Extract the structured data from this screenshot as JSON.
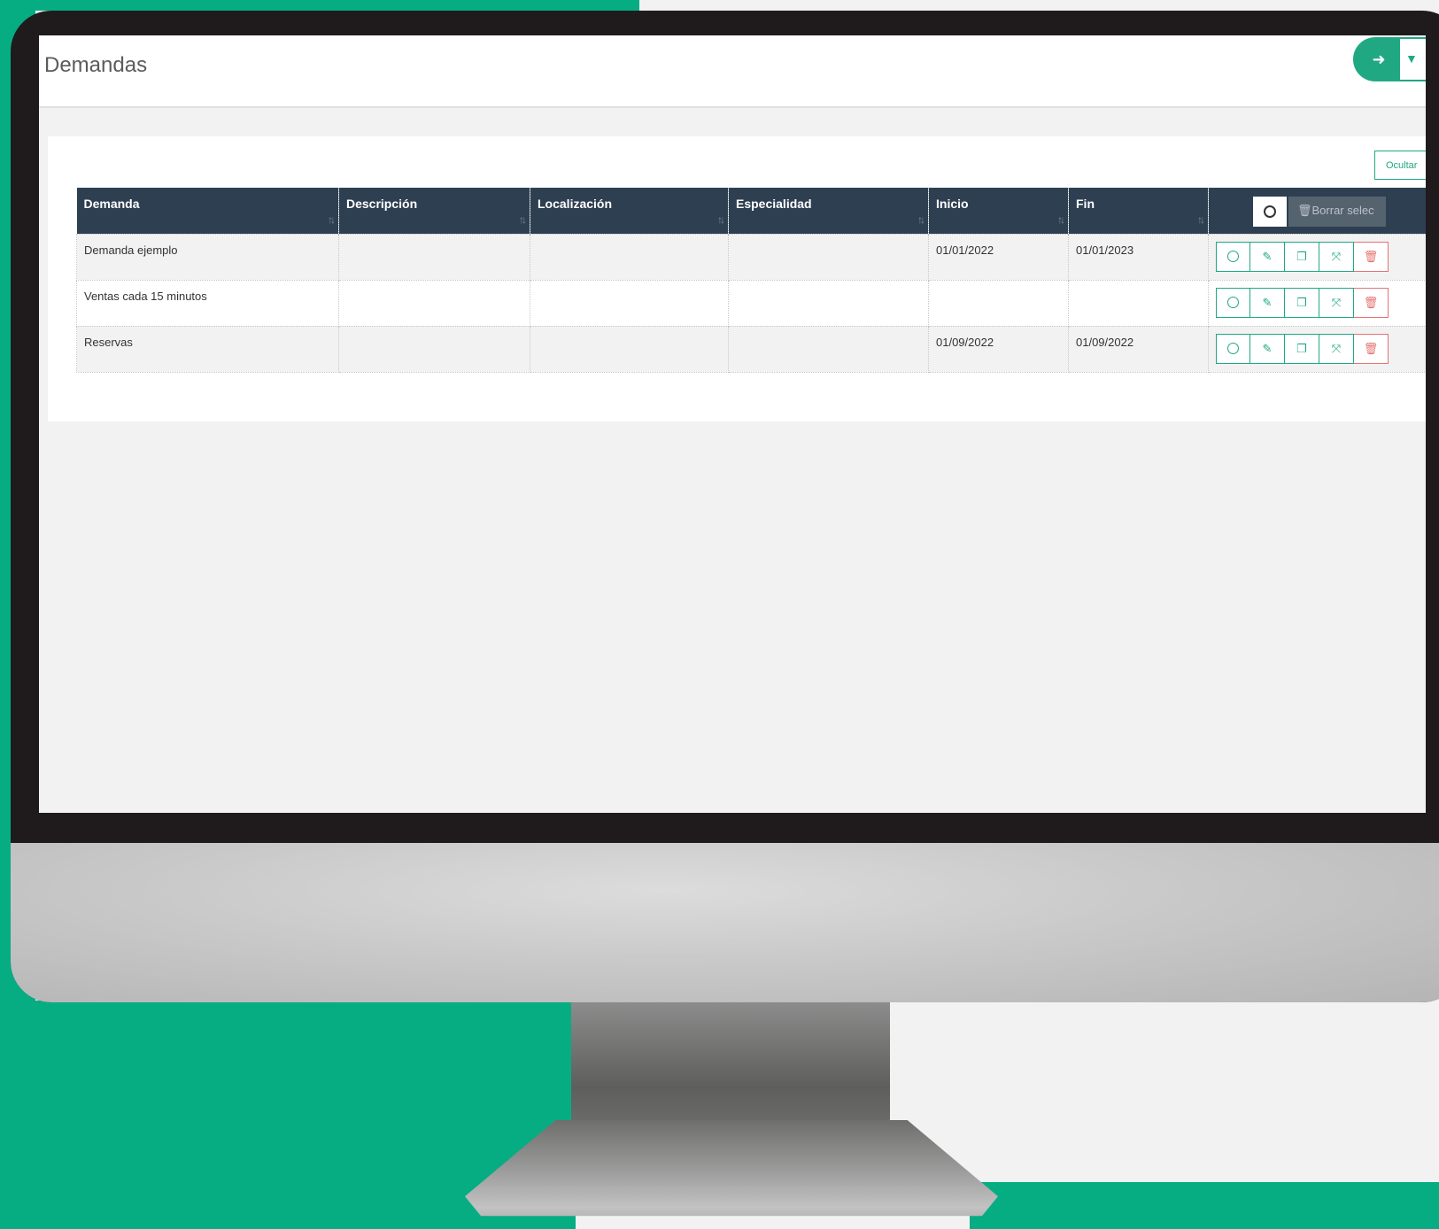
{
  "page": {
    "title": "Demandas",
    "next_icon": "arrow-right-icon",
    "filter_icon": "filter-icon"
  },
  "toolbar": {
    "hide_label": "Ocultar"
  },
  "table": {
    "columns": [
      {
        "label": "Demanda"
      },
      {
        "label": "Descripción"
      },
      {
        "label": "Localización"
      },
      {
        "label": "Especialidad"
      },
      {
        "label": "Inicio"
      },
      {
        "label": "Fin"
      }
    ],
    "bulk_delete_label": "Borrar selec",
    "rows": [
      {
        "demanda": "Demanda ejemplo",
        "descripcion": "",
        "localizacion": "",
        "especialidad": "",
        "inicio": "01/01/2022",
        "fin": "01/01/2023"
      },
      {
        "demanda": "Ventas cada 15 minutos",
        "descripcion": "",
        "localizacion": "",
        "especialidad": "",
        "inicio": "",
        "fin": ""
      },
      {
        "demanda": "Reservas",
        "descripcion": "",
        "localizacion": "",
        "especialidad": "",
        "inicio": "01/09/2022",
        "fin": "01/09/2022"
      }
    ],
    "row_actions": [
      "select-radio-icon",
      "edit-icon",
      "copy-icon",
      "collapse-icon",
      "trash-icon"
    ]
  },
  "colors": {
    "accent": "#20a883",
    "header_bg": "#2e3f51",
    "danger": "#e57373",
    "backdrop_green": "#06ad83"
  }
}
